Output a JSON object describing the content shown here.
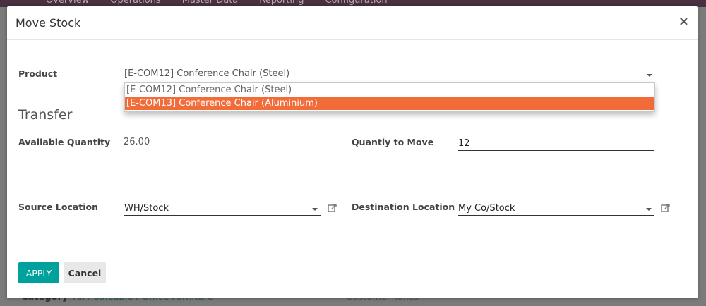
{
  "background": {
    "menu": [
      "Overview",
      "Operations",
      "Master Data",
      "Reporting",
      "Configuration"
    ],
    "category_label": "Category",
    "category_value": "All / Saleable / Office Furniture",
    "customer_taxes_label": "Customer Taxes"
  },
  "modal": {
    "title": "Move Stock",
    "close_symbol": "×"
  },
  "product": {
    "label": "Product",
    "value": "[E-COM12] Conference Chair (Steel)",
    "options": [
      "[E-COM12] Conference Chair (Steel)",
      "[E-COM13] Conference Chair (Aluminium)"
    ]
  },
  "transfer": {
    "section_title": "Transfer",
    "available_quantity_label": "Available Quantity",
    "available_quantity_value": "26.00",
    "quantity_to_move_label": "Quantiy to Move",
    "quantity_to_move_value": "12",
    "source_location_label": "Source Location",
    "source_location_value": "WH/Stock",
    "destination_location_label": "Destination Location",
    "destination_location_value": "My Co/Stock"
  },
  "footer": {
    "apply_label": "APPLY",
    "cancel_label": "Cancel"
  },
  "colors": {
    "primary": "#00a09d",
    "highlight": "#f26c3a",
    "header_bar": "#4a3041"
  }
}
